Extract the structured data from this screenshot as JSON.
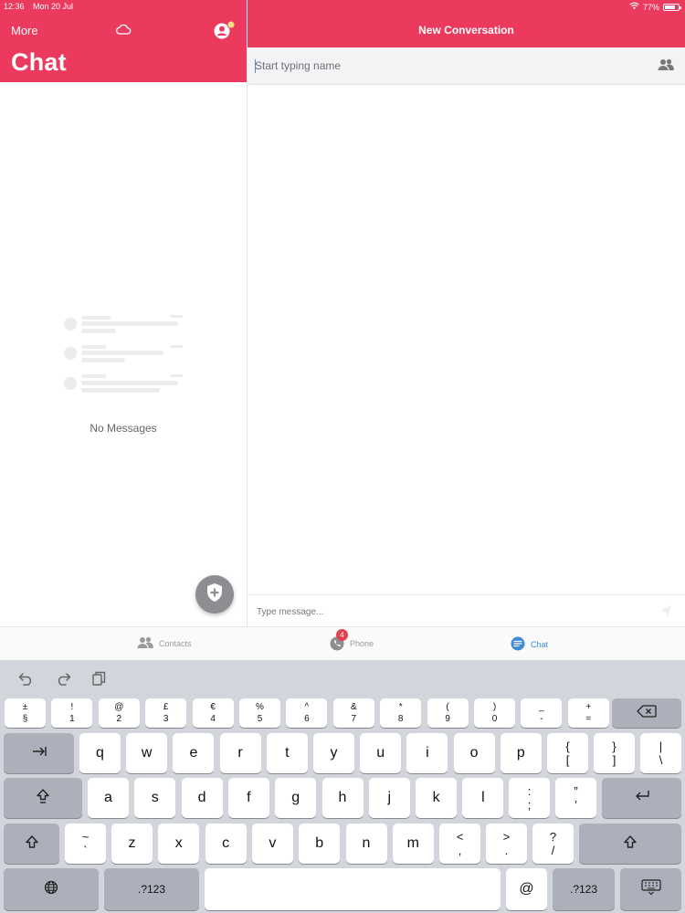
{
  "status_bar": {
    "time": "12:36",
    "date": "Mon 20 Jul",
    "battery": "77%",
    "battery_level": 0.77
  },
  "left_pane": {
    "more_label": "More",
    "title": "Chat",
    "empty_state": "No Messages"
  },
  "right_pane": {
    "title": "New Conversation",
    "to_placeholder": "Start typing name",
    "message_placeholder": "Type message..."
  },
  "tabs": [
    {
      "label": "Contacts",
      "icon": "contacts-icon",
      "active": false
    },
    {
      "label": "Phone",
      "icon": "phone-icon",
      "badge": "4",
      "active": false
    },
    {
      "label": "Chat",
      "icon": "chat-icon",
      "active": true
    }
  ],
  "colors": {
    "accent": "#ec3a5f",
    "active_tab": "#3d8bd8",
    "badge": "#e0434c",
    "fab": "#8e8e92"
  },
  "keyboard": {
    "shortcuts": [
      "undo-icon",
      "redo-icon",
      "paste-icon"
    ],
    "number_row": [
      {
        "top": "±",
        "bottom": "§"
      },
      {
        "top": "!",
        "bottom": "1"
      },
      {
        "top": "@",
        "bottom": "2"
      },
      {
        "top": "£",
        "bottom": "3"
      },
      {
        "top": "€",
        "bottom": "4"
      },
      {
        "top": "%",
        "bottom": "5"
      },
      {
        "top": "^",
        "bottom": "6"
      },
      {
        "top": "&",
        "bottom": "7"
      },
      {
        "top": "*",
        "bottom": "8"
      },
      {
        "top": "(",
        "bottom": "9"
      },
      {
        "top": ")",
        "bottom": "0"
      },
      {
        "top": "_",
        "bottom": "-"
      },
      {
        "top": "+",
        "bottom": "="
      }
    ],
    "row_q": [
      "q",
      "w",
      "e",
      "r",
      "t",
      "y",
      "u",
      "i",
      "o",
      "p"
    ],
    "row_q_symbols": [
      {
        "top": "{",
        "bottom": "["
      },
      {
        "top": "}",
        "bottom": "]"
      },
      {
        "top": "|",
        "bottom": "\\"
      }
    ],
    "row_a": [
      "a",
      "s",
      "d",
      "f",
      "g",
      "h",
      "j",
      "k",
      "l"
    ],
    "row_a_symbols": [
      {
        "top": ":",
        "bottom": ";"
      },
      {
        "top": "”",
        "bottom": "’"
      }
    ],
    "row_z": [
      "z",
      "x",
      "c",
      "v",
      "b",
      "n",
      "m"
    ],
    "row_z_symbols": [
      {
        "top": "~",
        "bottom": "`"
      },
      {
        "top": "<",
        "bottom": ","
      },
      {
        "top": ">",
        "bottom": "."
      },
      {
        "top": "?",
        "bottom": "/"
      }
    ],
    "at_key": "@",
    "numbers_key": ".?123"
  }
}
